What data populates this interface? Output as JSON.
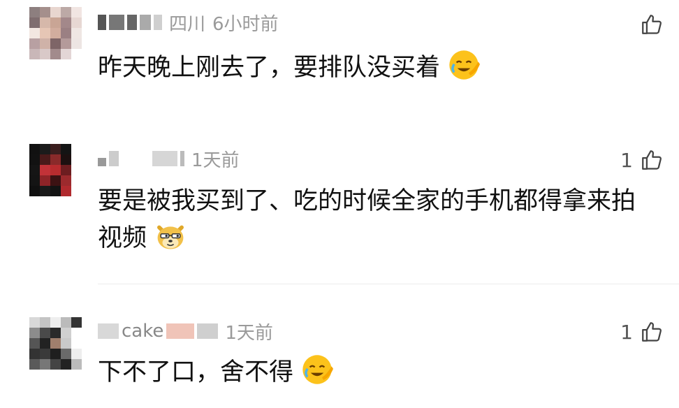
{
  "comments": [
    {
      "username": "",
      "location": "四川",
      "time": "6小时前",
      "likes": "",
      "text": "昨天晚上刚去了，要排队没买着",
      "emoji": "facepalm-laugh-cry-emoji"
    },
    {
      "username": "",
      "location": "",
      "time": "1天前",
      "likes": "1",
      "text": "要是被我买到了、吃的时候全家的手机都得拿来拍视频",
      "emoji": "doge-sunglasses-emoji"
    },
    {
      "username": "cake",
      "location": "",
      "time": "1天前",
      "likes": "1",
      "text": "下不了口，舍不得",
      "emoji": "facepalm-laugh-cry-emoji"
    }
  ],
  "colors": {
    "meta": "#9a9a9a",
    "text": "#111111",
    "divider": "#ececec"
  }
}
